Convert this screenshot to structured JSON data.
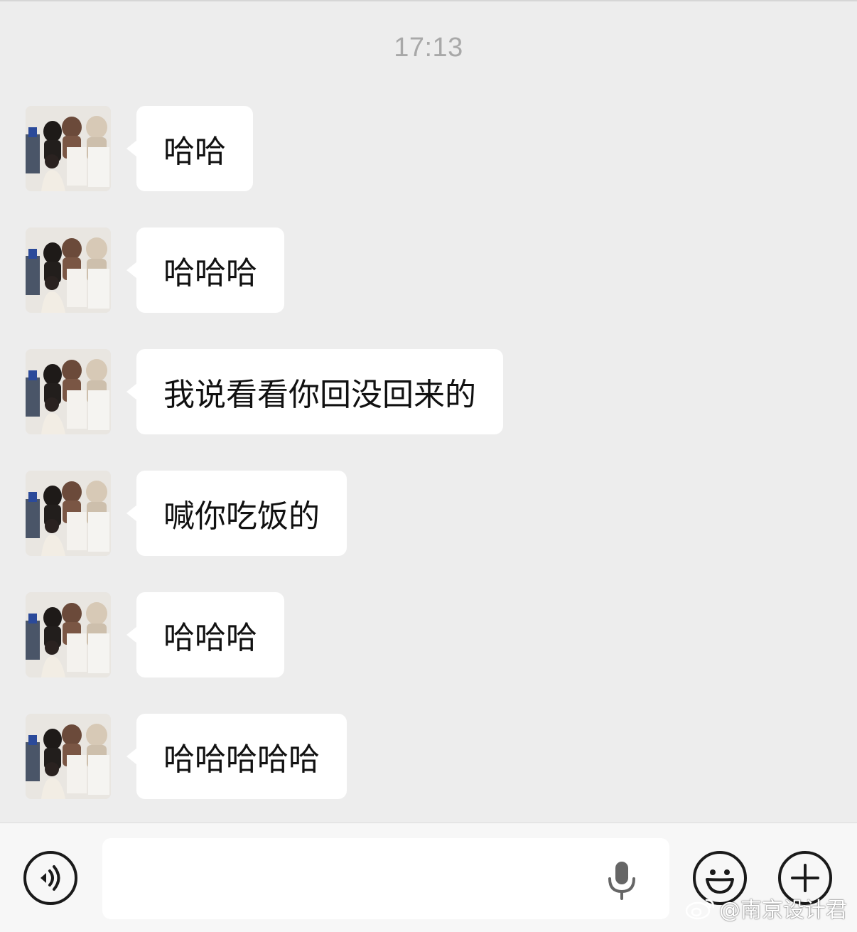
{
  "chat": {
    "timestamp": "17:13",
    "messages": [
      {
        "text": "哈哈"
      },
      {
        "text": "哈哈哈"
      },
      {
        "text": "我说看看你回没回来的"
      },
      {
        "text": "喊你吃饭的"
      },
      {
        "text": "哈哈哈"
      },
      {
        "text": "哈哈哈哈哈"
      }
    ]
  },
  "input_bar": {
    "input_value": "",
    "icons": {
      "voice": "voice-mode-icon",
      "mic": "microphone-icon",
      "emoji": "emoji-icon",
      "plus": "plus-icon"
    }
  },
  "watermark": {
    "text": "@南京设计君"
  },
  "colors": {
    "background": "#ededed",
    "bubble": "#ffffff",
    "timestamp": "#a8a8a8",
    "input_bar": "#f7f7f7"
  }
}
